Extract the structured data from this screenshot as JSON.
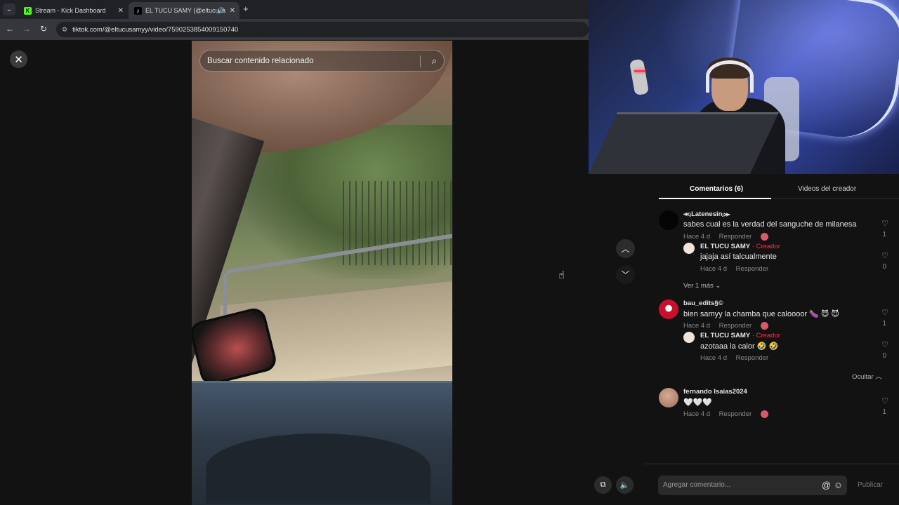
{
  "browser": {
    "tab_list_icon": "⌄",
    "tabs": [
      {
        "favicon": "K",
        "title": "Stream - Kick Dashboard"
      },
      {
        "favicon": "♪",
        "title": "EL TUCU SAMY (@eltucusa"
      }
    ],
    "new_tab_icon": "+",
    "back_icon": "←",
    "forward_icon": "→",
    "reload_icon": "↻",
    "url": "tiktok.com/@eltucusamyy/video/7590253854009150740"
  },
  "video": {
    "search_placeholder": "Buscar contenido relacionado",
    "close_icon": "✕",
    "prev_icon": "︿",
    "next_icon": "﹀"
  },
  "panel": {
    "tabs": [
      "Comentarios (6)",
      "Videos del creador"
    ],
    "comments": [
      {
        "author": "⪻ⱼLatenesinⱼ⪼",
        "text": "sabes cual es la verdad del sanguche de milanesa",
        "time": "Hace 4 d",
        "reply": "Responder",
        "likes": "1",
        "avatar_color": "#050505",
        "replies": [
          {
            "author": "EL TUCU SAMY",
            "badge": " · Creador",
            "text": "jajaja así talcualmente",
            "time": "Hace 4 d",
            "reply": "Responder",
            "likes": "0"
          }
        ],
        "toggle": "Ver 1 más ⌄"
      },
      {
        "author": "bau_edits§©",
        "text": "bien samyy la chamba que caloooor 🍆 😈 😈",
        "time": "Hace 4 d",
        "reply": "Responder",
        "likes": "1",
        "avatar_color": "#c8102e",
        "replies": [
          {
            "author": "EL TUCU SAMY",
            "badge": " · Creador",
            "text": "azotaaa la calor 🤣 🤣",
            "time": "Hace 4 d",
            "reply": "Responder",
            "likes": "0"
          }
        ],
        "toggle": "Ocultar ︿"
      },
      {
        "author": "fernando Isaias2024",
        "text": "🤍🤍🤍",
        "time": "Hace 4 d",
        "reply": "Responder",
        "likes": "1",
        "avatar_color": "#b88a78"
      }
    ],
    "add_comment_placeholder": "Agregar comentario...",
    "mention_icon": "@",
    "emoji_icon": "☺",
    "publish_label": "Publicar"
  }
}
